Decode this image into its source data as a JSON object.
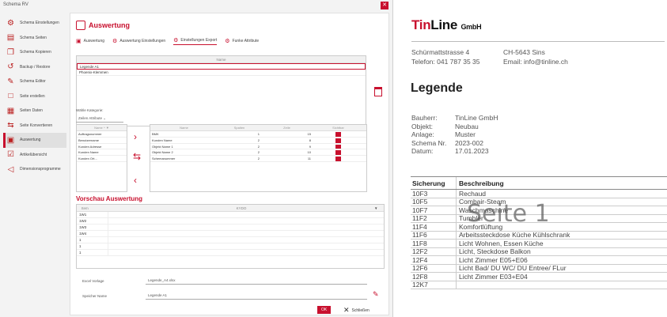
{
  "window": {
    "title": "Schema RV"
  },
  "sidebar": {
    "items": [
      {
        "label": "Schema Einstellungen",
        "icon": "gear-icon"
      },
      {
        "label": "Schema Seiten",
        "icon": "pages-icon"
      },
      {
        "label": "Schema Kopieren",
        "icon": "copy-icon"
      },
      {
        "label": "Backup / Restore",
        "icon": "restore-icon"
      },
      {
        "label": "Schema Editor",
        "icon": "wrench-icon"
      },
      {
        "label": "Seite erstellen",
        "icon": "new-page-icon"
      },
      {
        "label": "Seiten Daten",
        "icon": "data-icon"
      },
      {
        "label": "Seite Konvertieren",
        "icon": "convert-icon"
      },
      {
        "label": "Auswertung",
        "icon": "report-icon",
        "active": true
      },
      {
        "label": "Artikelübersicht",
        "icon": "article-icon"
      },
      {
        "label": "Dimensionsprogramme",
        "icon": "dimension-icon"
      }
    ]
  },
  "panel": {
    "title": "Auswertung",
    "tabs": [
      "Auswertung",
      "Auswertung Einstellungen",
      "Einstellungen Export",
      "Funke Attribute"
    ],
    "active_tab": 2,
    "grid_header": "Name",
    "grid_rows": [
      "Legende A1",
      "Phoenix-Klemmen"
    ],
    "wahle_label": "Wähle Kategorie:",
    "wahle_value": "Zeilen Attribute",
    "left_header": [
      "Name",
      "^"
    ],
    "left_rows": [
      "Auftragsnummer",
      "Benutzername",
      "Kunden Adresse",
      "Kunden Name",
      "Kunden Ort..."
    ],
    "right_header": [
      "Name",
      "Spalten",
      "Zeile",
      "Sichtbar"
    ],
    "right_rows": [
      {
        "name": "BMK",
        "spalten": "1",
        "zeile": "15"
      },
      {
        "name": "Kunden Name",
        "spalten": "2",
        "zeile": "8"
      },
      {
        "name": "Objekt Name 1",
        "spalten": "2",
        "zeile": "9"
      },
      {
        "name": "Objekt Name 2",
        "spalten": "2",
        "zeile": "10"
      },
      {
        "name": "Schemanummer",
        "spalten": "2",
        "zeile": "11"
      }
    ],
    "preview_title": "Vorschau Auswertung",
    "preview_header": [
      "Item",
      "KYDO"
    ],
    "preview_rows": [
      "1W1",
      "1W2",
      "1W3",
      "1W4",
      "1",
      "1",
      "1"
    ],
    "excel_label": "Excel Vorlage",
    "excel_value": "Legende_A4.xlsx",
    "save_label": "Speicher Name",
    "save_value": "Legende A1",
    "ok_label": "OK",
    "close_label": "Schließen"
  },
  "doc": {
    "logo_tin": "Tin",
    "logo_line": "Line",
    "logo_gmbh": "GmbH",
    "street": "Schürmattstrasse 4",
    "city": "CH-5643 Sins",
    "phone": "Telefon: 041 787 35 35",
    "email": "Email: info@tinline.ch",
    "heading": "Legende",
    "info": [
      {
        "k": "Bauherr:",
        "v": "TinLine GmbH"
      },
      {
        "k": "Objekt:",
        "v": "Neubau"
      },
      {
        "k": "Anlage:",
        "v": "Muster"
      },
      {
        "k": "Schema Nr.",
        "v": "2023-002"
      },
      {
        "k": "Datum:",
        "v": "17.01.2023"
      }
    ],
    "table_head": {
      "c1": "Sicherung",
      "c2": "Beschreibung"
    },
    "table_rows": [
      {
        "c1": "10F3",
        "c2": "Rechaud"
      },
      {
        "c1": "10F5",
        "c2": "Combair-Steam"
      },
      {
        "c1": "10F7",
        "c2": "Waschmaschine"
      },
      {
        "c1": "11F2",
        "c2": "Tumbler"
      },
      {
        "c1": "11F4",
        "c2": "Komfortlüftung"
      },
      {
        "c1": "11F6",
        "c2": "Arbeitssteckdose Küche Kühlschrank"
      },
      {
        "c1": "11F8",
        "c2": "Licht Wohnen, Essen Küche"
      },
      {
        "c1": "12F2",
        "c2": "Licht, Steckdose Balkon"
      },
      {
        "c1": "12F4",
        "c2": "Licht Zimmer E05+E06"
      },
      {
        "c1": "12F6",
        "c2": "Licht Bad/ DU WC/ DU Entree/ FLur"
      },
      {
        "c1": "12F8",
        "c2": "Licht Zimmer E03+E04"
      },
      {
        "c1": "12K7",
        "c2": ""
      }
    ],
    "watermark": "Seite 1"
  },
  "colors": {
    "accent": "#c8102e"
  }
}
